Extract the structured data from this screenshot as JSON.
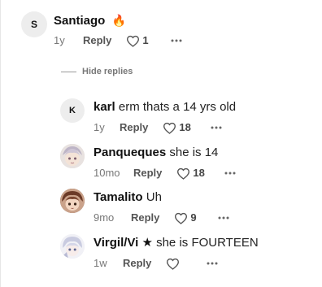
{
  "top_comment": {
    "avatar_initial": "S",
    "author": "Santiago",
    "emoji": "🔥",
    "time": "1y",
    "reply_label": "Reply",
    "likes": "1",
    "more_icon": "ellipsis-icon"
  },
  "hide_replies_label": "Hide replies",
  "replies": [
    {
      "avatar_type": "initial",
      "avatar_initial": "K",
      "author": "karl",
      "text": "erm thats a 14 yrs old",
      "time": "1y",
      "reply_label": "Reply",
      "likes": "18"
    },
    {
      "avatar_type": "picture",
      "author": "Panqueques",
      "text": "she is 14",
      "time": "10mo",
      "reply_label": "Reply",
      "likes": "18"
    },
    {
      "avatar_type": "picture",
      "author": "Tamalito",
      "text": "Uh",
      "time": "9mo",
      "reply_label": "Reply",
      "likes": "9"
    },
    {
      "avatar_type": "picture",
      "author": "Virgil/Vi ★",
      "text": "she is FOURTEEN",
      "time": "1w",
      "reply_label": "Reply",
      "likes": ""
    }
  ],
  "colors": {
    "text": "#1f1f1f",
    "meta": "#777777",
    "avatar_bg": "#ededed",
    "border": "#e6e6e6"
  }
}
